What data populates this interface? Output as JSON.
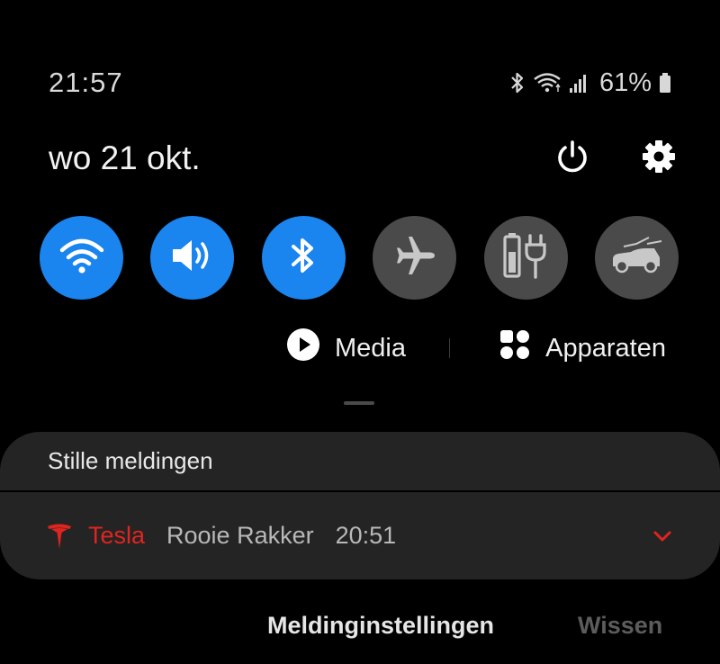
{
  "status": {
    "time": "21:57",
    "battery_percent": "61%",
    "icons": [
      "bluetooth-icon",
      "wifi-icon",
      "signal-icon",
      "battery-icon"
    ]
  },
  "header": {
    "date": "wo 21 okt.",
    "icons": [
      "power-icon",
      "gear-icon"
    ]
  },
  "quick_tiles": [
    {
      "name": "wifi",
      "icon": "wifi-icon",
      "state": "on"
    },
    {
      "name": "sound",
      "icon": "volume-icon",
      "state": "on"
    },
    {
      "name": "bluetooth",
      "icon": "bluetooth-icon",
      "state": "on"
    },
    {
      "name": "airplane",
      "icon": "airplane-icon",
      "state": "off"
    },
    {
      "name": "power-saving",
      "icon": "battery-plug-icon",
      "state": "off"
    },
    {
      "name": "car",
      "icon": "car-icon",
      "state": "off"
    }
  ],
  "media_row": {
    "media_label": "Media",
    "devices_label": "Apparaten"
  },
  "notifications": {
    "section_title": "Stille meldingen",
    "items": [
      {
        "app": "Tesla",
        "title": "Rooie Rakker",
        "time": "20:51"
      }
    ]
  },
  "footer": {
    "settings_label": "Meldinginstellingen",
    "clear_label": "Wissen"
  },
  "colors": {
    "accent": "#1a84ef",
    "tile_off": "#4a4a4a",
    "card": "#242424",
    "tesla_red": "#e02420"
  }
}
